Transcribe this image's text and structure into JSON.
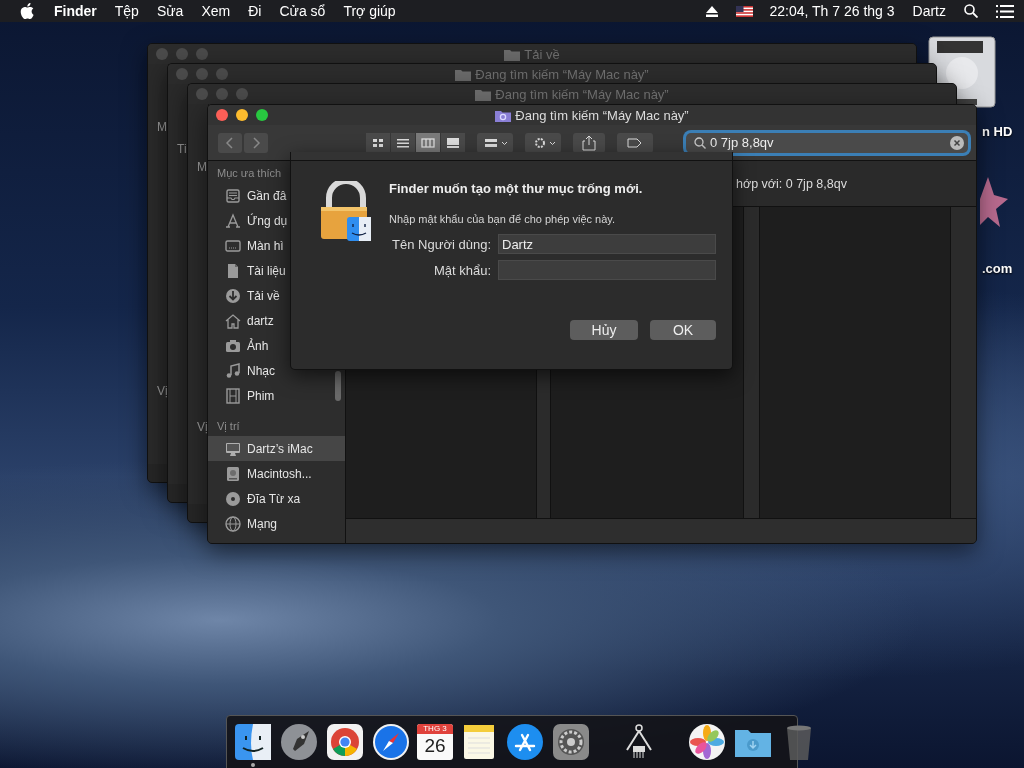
{
  "menu_bar": {
    "menus": [
      {
        "label": "Finder",
        "kind": "app"
      },
      {
        "label": "Tệp",
        "kind": "menu"
      },
      {
        "label": "Sửa",
        "kind": "menu"
      },
      {
        "label": "Xem",
        "kind": "menu"
      },
      {
        "label": "Đi",
        "kind": "menu"
      },
      {
        "label": "Cửa sổ",
        "kind": "menu"
      },
      {
        "label": "Trợ giúp",
        "kind": "menu"
      }
    ],
    "clock": "22:04, Th 7 26 thg 3",
    "user": "Dartz"
  },
  "desktop_icons": [
    {
      "label": "n HD",
      "kind": "drive"
    },
    {
      "label": ".com",
      "kind": "star"
    }
  ],
  "background_windows": [
    {
      "title": "Tải về",
      "sidebar_fragments": [
        "M",
        "Vị"
      ]
    },
    {
      "title": "Đang tìm kiếm “Máy Mac này”",
      "sidebar_fragments": [
        "Ti"
      ]
    },
    {
      "title": "Đang tìm kiếm “Máy Mac này”",
      "sidebar_fragments": [
        "M",
        "Vị"
      ]
    }
  ],
  "finder_window": {
    "title": "Đang tìm kiếm “Máy Mac này”",
    "view_buttons": [
      {
        "kind": "icons",
        "selected": false
      },
      {
        "kind": "list",
        "selected": false
      },
      {
        "kind": "columns",
        "selected": true
      },
      {
        "kind": "gallery",
        "selected": false
      }
    ],
    "search": {
      "value": "0 7jp 8,8qv"
    },
    "scope_text": "hớp với: 0 7jp 8,8qv",
    "sidebar": [
      {
        "heading": "Mục ưa thích",
        "items": [
          {
            "label": "Gần đâ",
            "kind": "recents",
            "selected": false
          },
          {
            "label": "Ứng dụ",
            "kind": "applications",
            "selected": false
          },
          {
            "label": "Màn hì",
            "kind": "desktop",
            "selected": false
          },
          {
            "label": "Tài liệu",
            "kind": "documents",
            "selected": false
          },
          {
            "label": "Tải về",
            "kind": "downloads",
            "selected": false
          },
          {
            "label": "dartz",
            "kind": "home",
            "selected": false
          },
          {
            "label": "Ảnh",
            "kind": "pictures",
            "selected": false
          },
          {
            "label": "Nhạc",
            "kind": "music",
            "selected": false
          },
          {
            "label": "Phim",
            "kind": "movies",
            "selected": false
          }
        ]
      },
      {
        "heading": "Vị trí",
        "items": [
          {
            "label": "Dartz’s iMac",
            "kind": "computer",
            "selected": true
          },
          {
            "label": "Macintosh...",
            "kind": "drive",
            "selected": false
          },
          {
            "label": "Đĩa Từ xa",
            "kind": "disc",
            "selected": false
          },
          {
            "label": "Mạng",
            "kind": "network",
            "selected": false
          }
        ]
      }
    ]
  },
  "dialog": {
    "title": "Finder muốn tạo một thư mục trống mới.",
    "message": "Nhập mật khẩu của bạn để cho phép việc này.",
    "fields": [
      {
        "label": "Tên Người dùng:",
        "kind": "text",
        "value": "Dartz"
      },
      {
        "label": "Mật khẩu:",
        "kind": "password"
      }
    ],
    "buttons": [
      {
        "label": "Hủy"
      },
      {
        "label": "OK"
      }
    ]
  },
  "dock": {
    "items": [
      {
        "kind": "finder",
        "running": true
      },
      {
        "kind": "launchpad",
        "running": false
      },
      {
        "kind": "chrome",
        "running": false
      },
      {
        "kind": "safari",
        "running": false
      },
      {
        "kind": "calendar",
        "running": false,
        "month": "THG 3",
        "day": "26"
      },
      {
        "kind": "notes",
        "running": false
      },
      {
        "kind": "appstore",
        "running": false
      },
      {
        "kind": "settings",
        "running": false
      },
      {
        "kind": "separator"
      },
      {
        "kind": "calipers",
        "running": false
      },
      {
        "kind": "separator"
      },
      {
        "kind": "photos",
        "running": false
      },
      {
        "kind": "folder",
        "running": false
      },
      {
        "kind": "trash",
        "running": false
      }
    ]
  }
}
